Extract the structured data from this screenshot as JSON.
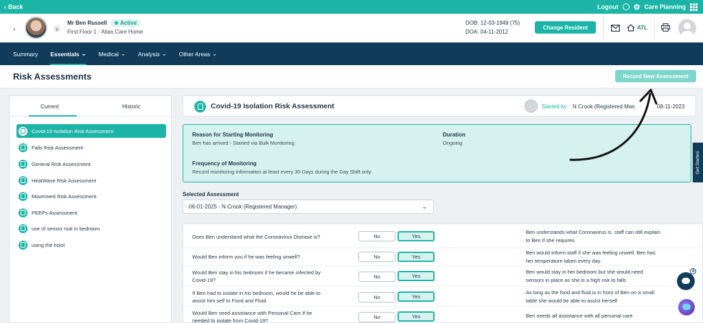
{
  "topbar": {
    "back_label": "Back",
    "logout_label": "Logout",
    "app_label": "Care Planning"
  },
  "resident": {
    "name": "Mr Ben Russell",
    "status": "Active",
    "location": "First Floor 1 - Atlas Care Home",
    "dob": "DOB: 12-03-1949 (75)",
    "doa": "DOA: 04-11-2012",
    "change_label": "Change Resident",
    "home_code": "ATL"
  },
  "nav": {
    "items": [
      {
        "label": "Summary",
        "active": false,
        "dropdown": false
      },
      {
        "label": "Essentials",
        "active": true,
        "dropdown": true
      },
      {
        "label": "Medical",
        "active": false,
        "dropdown": true
      },
      {
        "label": "Analysis",
        "active": false,
        "dropdown": true
      },
      {
        "label": "Other Areas",
        "active": false,
        "dropdown": true
      }
    ]
  },
  "page": {
    "title": "Risk Assessments",
    "record_label": "Record New Assessment"
  },
  "sidebar": {
    "tabs": [
      "Current",
      "Historic"
    ],
    "items": [
      {
        "label": "Covid-19 Isolation Risk Assessment",
        "active": true
      },
      {
        "label": "Falls Risk Assessment",
        "active": false
      },
      {
        "label": "General Risk Assessment",
        "active": false
      },
      {
        "label": "HeatWave Risk Assessment",
        "active": false
      },
      {
        "label": "Movement Risk Assessment",
        "active": false
      },
      {
        "label": "PEEPs Assessment",
        "active": false
      },
      {
        "label": "use of sensor mat in bedroom",
        "active": false
      },
      {
        "label": "using the hoist",
        "active": false
      }
    ]
  },
  "assessment": {
    "title": "Covid-19 Isolation Risk Assessment",
    "started_label": "Started by",
    "started_by": "N Crook (Registered Man",
    "date": "08-11-2023",
    "reason_label": "Reason for Starting Monitoring",
    "reason": "Ben has arrived - Started via Bulk Monitoring",
    "duration_label": "Duration",
    "duration": "Ongoing",
    "frequency_label": "Frequency of Monitoring",
    "frequency": "Record monitoring information at least every 30 Days during the Day Shift only.",
    "selected_label": "Selected Assessment",
    "selected_value": "06-01-2025 - N Crook (Registered Manager)"
  },
  "questions": [
    {
      "q1": "Does Ben understand what the Coronavirus Disease is?",
      "q2": "",
      "no": "No",
      "yes": "Yes",
      "answer": "Yes",
      "c1": "Ben understands what Coronavirus is, staff can still explain",
      "c2": "to Ben if she requires"
    },
    {
      "q1": "Would Ben inform you if he was feeling unwell?",
      "q2": "",
      "no": "No",
      "yes": "Yes",
      "answer": "Yes",
      "c1": "Ben would inform staff if she was feeling unwell. Ben has",
      "c2": "her temperature taken every day."
    },
    {
      "q1": "Would Ben stay in his bedroom if he became infected by",
      "q2": "Covid-19?",
      "no": "No",
      "yes": "Yes",
      "answer": "Yes",
      "c1": "Ben would stay in her bedroom but she would need",
      "c2": "sensors in place as she is a high risk to falls"
    },
    {
      "q1": "If Ben had to isolate in his bedroom, would he be able to",
      "q2": "assist him self to Food and Fluid.",
      "no": "No",
      "yes": "Yes",
      "answer": "Yes",
      "c1": "As long as the food and fluid is in front of Ben on a small",
      "c2": "table she would be able to assist herself"
    },
    {
      "q1": "Would Ben need assistance with Personal Care if he",
      "q2": "needed to isolate from Covid-19?",
      "no": "No",
      "yes": "Yes",
      "answer": "Yes",
      "c1": "Ben needs all assistance with all personal care",
      "c2": ""
    }
  ],
  "widgets": {
    "get_started": "Get Started",
    "chat_count": "4"
  },
  "colors": {
    "accent": "#1cb4a6",
    "navy": "#103c5a",
    "info_bg": "#d6f2ee"
  }
}
